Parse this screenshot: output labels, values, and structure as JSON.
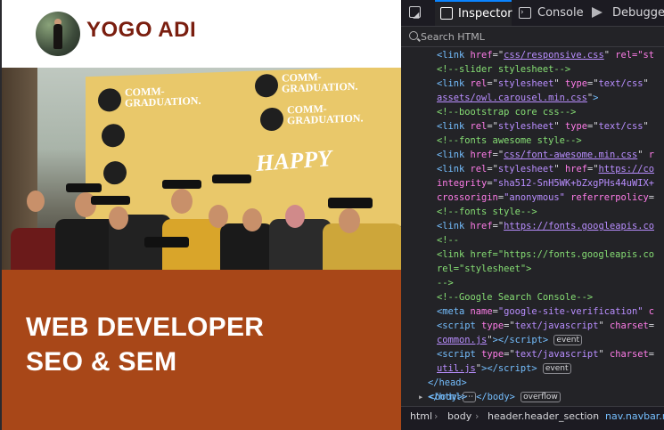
{
  "site": {
    "brand": "YOGO ADI",
    "banner_lines": [
      "COMM-",
      "GRADUATION.",
      "COMM-",
      "GRADUATION.",
      "COMM-",
      "GRADUATION."
    ],
    "banner_happy": "HAPPY",
    "roles": [
      "WEB DEVELOPER",
      "SEO & SEM"
    ],
    "colors": {
      "brand_text": "#7a1e0f",
      "hero_box": "#a84718"
    }
  },
  "devtools": {
    "tabs": [
      {
        "label": "Inspector",
        "icon": "inspector-icon",
        "active": true
      },
      {
        "label": "Console",
        "icon": "console-icon",
        "active": false
      },
      {
        "label": "Debugger",
        "icon": "debugger-icon",
        "active": false
      }
    ],
    "search": {
      "placeholder": "Search HTML",
      "value": ""
    },
    "lines": [
      {
        "link1_href": "css/responsive.css",
        "link1_rel": " rel=\"st"
      },
      {
        "c1": "<!--slider stylesheet-->"
      },
      {
        "href": "assets/owl.carousel.min.css"
      },
      {
        "c2": "<!--bootstrap core css-->"
      },
      {
        "c3": "<!--fonts awesome style-->"
      },
      {
        "fa_href": "css/font-awesome.min.css",
        "fa_tail": " r"
      },
      {
        "ext_href": "https://co"
      },
      {
        "integrity": "\"sha512-SnH5WK+bZxgPHs44uWIX+"
      },
      {
        "crossorigin": "\"anonymous\""
      },
      {
        "c4": "<!--fonts style-->"
      },
      {
        "gf_href": "https://fonts.googleapis.co"
      },
      {
        "c5_open": "<!--"
      },
      {
        "c5_body": "<link href=\"https://fonts.googleapis.co"
      },
      {
        "c5_rel": "rel=\"stylesheet\">"
      },
      {
        "c5_close": "-->"
      },
      {
        "c6": "<!--Google Search Console-->"
      },
      {
        "meta_name": "\"google-site-verification\""
      },
      {
        "script1_src": "common.js",
        "badge": "event"
      },
      {
        "script2_src": "util.js"
      }
    ],
    "body_badge": "overflow",
    "ellipsis": "⋯",
    "breadcrumbs": [
      "html",
      "body",
      "header.header_section",
      "nav.navbar.na"
    ]
  }
}
